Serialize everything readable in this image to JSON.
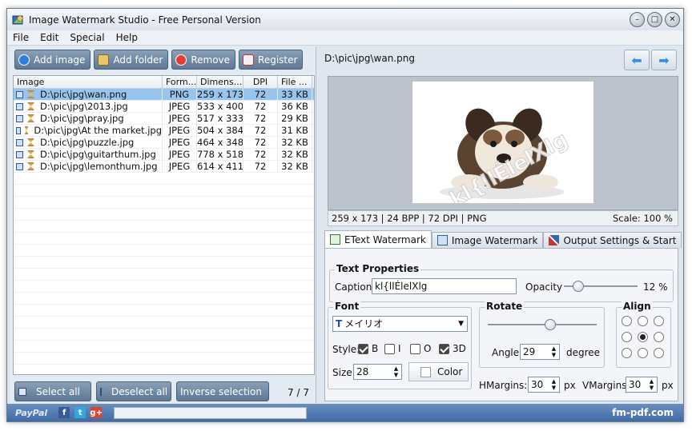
{
  "window": {
    "title": "Image Watermark Studio - Free Personal Version"
  },
  "menu": [
    "File",
    "Edit",
    "Special",
    "Help"
  ],
  "toolbar": {
    "add_image": "Add image",
    "add_folder": "Add folder",
    "remove": "Remove",
    "register": "Register"
  },
  "list": {
    "headers": [
      "Image",
      "Form...",
      "Dimens...",
      "DPI",
      "File ..."
    ],
    "rows": [
      {
        "path": "D:\\pic\\jpg\\wan.png",
        "format": "PNG",
        "dims": "259 x 173",
        "dpi": "72",
        "size": "33 KB"
      },
      {
        "path": "D:\\pic\\jpg\\2013.jpg",
        "format": "JPEG",
        "dims": "533 x 400",
        "dpi": "72",
        "size": "36 KB"
      },
      {
        "path": "D:\\pic\\jpg\\pray.jpg",
        "format": "JPEG",
        "dims": "517 x 333",
        "dpi": "72",
        "size": "29 KB"
      },
      {
        "path": "D:\\pic\\jpg\\At the market.jpg",
        "format": "JPEG",
        "dims": "504 x 384",
        "dpi": "72",
        "size": "31 KB"
      },
      {
        "path": "D:\\pic\\jpg\\puzzle.jpg",
        "format": "JPEG",
        "dims": "464 x 348",
        "dpi": "72",
        "size": "32 KB"
      },
      {
        "path": "D:\\pic\\jpg\\guitarthum.jpg",
        "format": "JPEG",
        "dims": "778 x 518",
        "dpi": "72",
        "size": "32 KB"
      },
      {
        "path": "D:\\pic\\jpg\\lemonthum.jpg",
        "format": "JPEG",
        "dims": "614 x 411",
        "dpi": "72",
        "size": "32 KB"
      }
    ]
  },
  "bottom": {
    "select_all": "Select all",
    "deselect_all": "Deselect all",
    "inverse": "Inverse selection",
    "count": "7 / 7"
  },
  "preview": {
    "path": "D:\\pic\\jpg\\wan.png",
    "watermark_text": "kl{llÉlelXlg",
    "info": "259 x 173  |  24 BPP  |  72 DPI  |  PNG",
    "scale": "Scale: 100 %"
  },
  "tabs": [
    "EText Watermark",
    "Image Watermark",
    "Output Settings & Start"
  ],
  "text_props": {
    "title": "Text Properties",
    "caption_label": "Caption:",
    "caption_value": "kl{llÉlelXlg",
    "opacity_label": "Opacity",
    "opacity_value": "12 %",
    "opacity": 0.12
  },
  "font": {
    "title": "Font",
    "name": "メイリオ",
    "style_label": "Style:",
    "bold": "B",
    "italic": "I",
    "outline": "O",
    "three_d": "3D",
    "size_label": "Size:",
    "size": "28",
    "color_label": "Color"
  },
  "rotate": {
    "title": "Rotate",
    "angle_label": "Angle:",
    "angle": "29",
    "unit": "degree"
  },
  "align": {
    "title": "Align"
  },
  "margins": {
    "h_label": "HMargins:",
    "h": "30",
    "h_unit": "px",
    "v_label": "VMargins:",
    "v": "30",
    "v_unit": "px"
  },
  "status": {
    "paypal": "PayPal",
    "facebook": "f",
    "twitter": "t",
    "googleplus": "g+",
    "brand": "fm-pdf.com"
  },
  "colors": {
    "accent": "#3f6ba6",
    "button": "#6e86a2",
    "selection": "#96c6ef"
  }
}
